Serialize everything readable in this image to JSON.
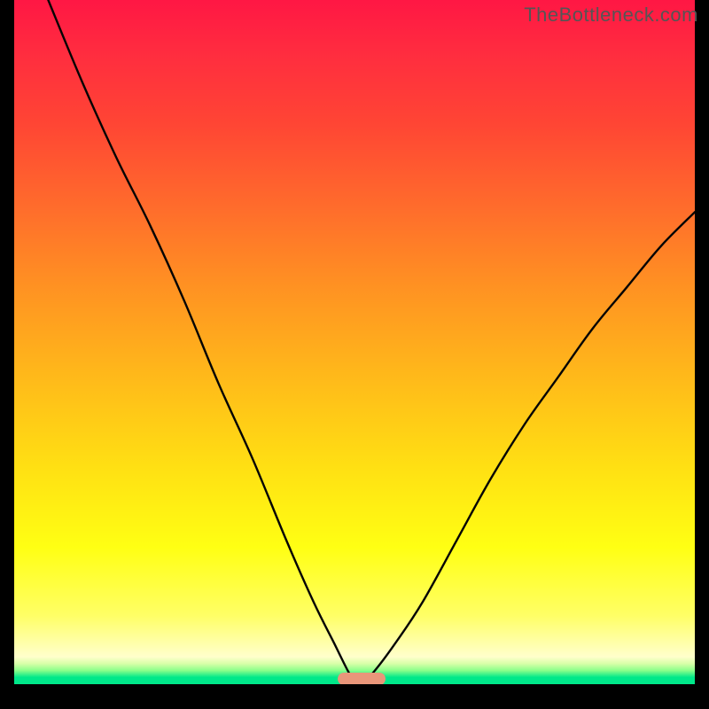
{
  "watermark": "TheBottleneck.com",
  "colors": {
    "top": "#ff1744",
    "mid": "#ffdf13",
    "bottom": "#00e88a",
    "marker": "#e9967a",
    "curve": "#040404",
    "frame": "#000000"
  },
  "chart_data": {
    "type": "line",
    "title": "",
    "xlabel": "",
    "ylabel": "",
    "x_range": [
      0,
      100
    ],
    "y_range": [
      0,
      100
    ],
    "min_x": 51,
    "min_marker_width_pct": 7,
    "series": [
      {
        "name": "left-branch",
        "x": [
          5,
          10,
          15,
          20,
          25,
          30,
          35,
          40,
          44,
          47,
          49,
          50,
          51
        ],
        "y": [
          100,
          88,
          77,
          67,
          56,
          44,
          33,
          21,
          12,
          6,
          2,
          0.5,
          0
        ]
      },
      {
        "name": "right-branch",
        "x": [
          51,
          53,
          56,
          60,
          65,
          70,
          75,
          80,
          85,
          90,
          95,
          100
        ],
        "y": [
          0,
          2,
          6,
          12,
          21,
          30,
          38,
          45,
          52,
          58,
          64,
          69
        ]
      }
    ],
    "annotations": [
      {
        "text": "TheBottleneck.com",
        "position": "top-right"
      }
    ]
  }
}
